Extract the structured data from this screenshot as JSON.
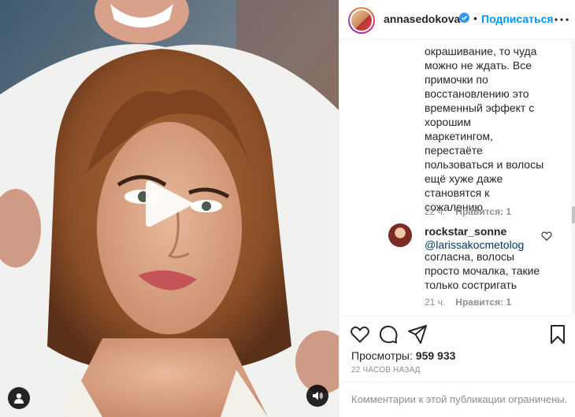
{
  "post": {
    "username": "annasedokova",
    "separator": "•",
    "follow_label": "Подписаться"
  },
  "comments": {
    "first": {
      "lines": [
        "окрашивание, то чуда",
        "можно не ждать. Все",
        "примочки по",
        "восстановлению это",
        "временный эффект с",
        "хорошим",
        "маркетингом,",
        "перестаёте",
        "пользоваться и волосы",
        "ещё хуже даже",
        "становятся к",
        "сожалению"
      ],
      "time": "22 ч.",
      "likes": "Нравится: 1"
    },
    "second": {
      "username": "rockstar_sonne",
      "mention": "@larissakocmetolog",
      "lines": [
        "согласна, волосы",
        "просто мочалка, такие",
        "только состригать"
      ],
      "time": "21 ч.",
      "likes": "Нравится: 1"
    }
  },
  "stats": {
    "views_label": "Просмотры:",
    "views_value": "959 933",
    "time": "22 ЧАСОВ НАЗАД"
  },
  "comment_box": {
    "message": "Комментарии к этой публикации ограничены."
  },
  "colors": {
    "accent": "#0095f6",
    "verified": "#3897f0",
    "mention": "#00376b",
    "muted": "#8e8e8e"
  },
  "icons": [
    "play-icon",
    "user-tag-icon",
    "sound-icon",
    "verified-icon",
    "more-icon",
    "heart-icon",
    "comment-icon",
    "share-icon",
    "bookmark-icon"
  ]
}
